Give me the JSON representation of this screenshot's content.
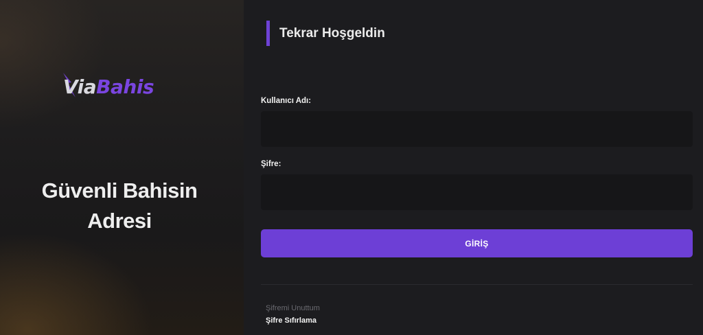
{
  "brand": {
    "logo_via": "Via",
    "logo_bahis": "Bahis",
    "slogan_line1": "Güvenli Bahisin",
    "slogan_line2": "Adresi",
    "accent_color": "#6d3fd6"
  },
  "login": {
    "title": "Tekrar Hoşgeldin",
    "username_label": "Kullanıcı Adı:",
    "username_value": "",
    "password_label": "Şifre:",
    "password_value": "",
    "submit_label": "GİRİŞ",
    "forgot_text": "Şifremi Unuttum",
    "reset_link": "Şifre Sıfırlama"
  },
  "icons": {
    "logo_bolt": "lightning-bolt-icon"
  }
}
